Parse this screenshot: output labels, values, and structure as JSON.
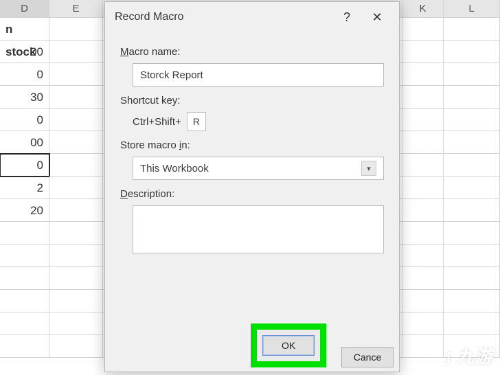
{
  "columns": [
    "D",
    "E",
    "",
    "K",
    "L"
  ],
  "rows": {
    "header": "n stock",
    "values": [
      "00",
      "0",
      "30",
      "0",
      "00",
      "0",
      "2",
      "20"
    ]
  },
  "active_row_index": 5,
  "dialog": {
    "title": "Record Macro",
    "help_glyph": "?",
    "close_glyph": "✕",
    "macro_name_label_pre": "M",
    "macro_name_label_post": "acro name:",
    "macro_name_value": "Storck Report",
    "shortcut_label": "Shortcut key:",
    "shortcut_prefix": "Ctrl+Shift+",
    "shortcut_key": "R",
    "store_label_pre": "Store macro ",
    "store_label_ul": "i",
    "store_label_post": "n:",
    "store_value": "This Workbook",
    "description_label_ul": "D",
    "description_label_post": "escription:",
    "ok_label": "OK",
    "cancel_label": "Cance"
  },
  "watermark": "九游"
}
